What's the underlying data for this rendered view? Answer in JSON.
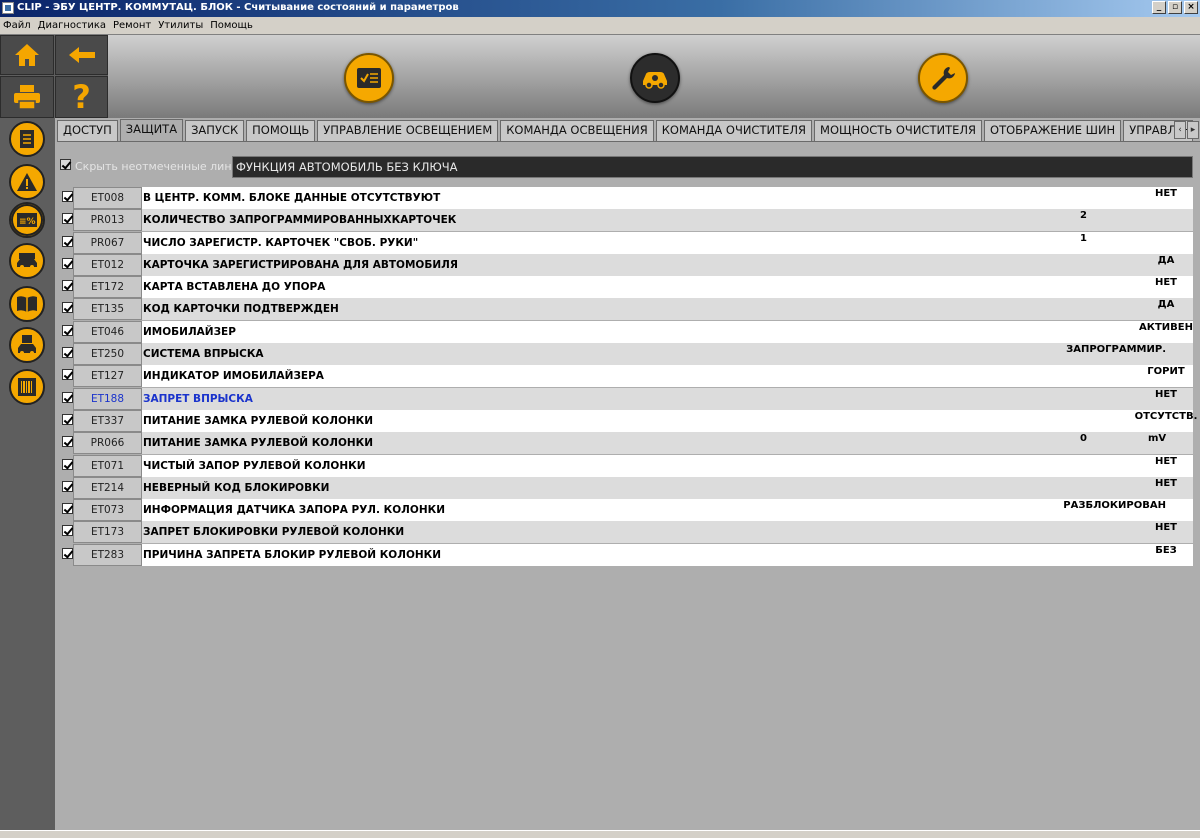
{
  "window": {
    "title": "CLIP - ЭБУ ЦЕНТР. КОММУТАЦ. БЛОК - Считывание состояний и параметров",
    "buttons": [
      "_",
      "▫",
      "×"
    ]
  },
  "menu": [
    "Файл",
    "Диагностика",
    "Ремонт",
    "Утилиты",
    "Помощь"
  ],
  "toolbar": {
    "home_icon": "home-icon",
    "back_icon": "back-arrow-icon",
    "print_icon": "printer-icon",
    "help_label": "?",
    "center_buttons": [
      "checklist-icon",
      "car-diagnostic-icon",
      "wrench-icon"
    ],
    "accent_color": "#f5a800"
  },
  "sidebar": {
    "icons": [
      "document-icon",
      "warning-icon",
      "parameters-icon",
      "vehicle-info-icon",
      "manual-book-icon",
      "save-vehicle-icon",
      "barcode-icon"
    ]
  },
  "tabs": [
    {
      "label": "ДОСТУП",
      "active": false
    },
    {
      "label": "ЗАЩИТА",
      "active": true
    },
    {
      "label": "ЗАПУСК",
      "active": false
    },
    {
      "label": "ПОМОЩЬ",
      "active": false
    },
    {
      "label": "УПРАВЛЕНИЕ ОСВЕЩЕНИЕМ",
      "active": false
    },
    {
      "label": "КОМАНДА ОСВЕЩЕНИЯ",
      "active": false
    },
    {
      "label": "КОМАНДА ОЧИСТИТЕЛЯ",
      "active": false
    },
    {
      "label": "МОЩНОСТЬ ОЧИСТИТЕЛЯ",
      "active": false
    },
    {
      "label": "ОТОБРАЖЕНИЕ ШИН",
      "active": false
    },
    {
      "label": "УПРАВЛЕНИЕ Г",
      "active": false
    }
  ],
  "filter": {
    "hide_unchecked_label": "Скрыть неотмеченные линии",
    "hide_unchecked_checked": true,
    "function_label": "ФУНКЦИЯ АВТОМОБИЛЬ БЕЗ КЛЮЧА"
  },
  "rows": [
    {
      "code": "ET008",
      "desc": "В ЦЕНТР. КОММ. БЛОКЕ ДАННЫЕ ОТСУТСТВУЮТ",
      "value": "НЕТ",
      "unit": ""
    },
    {
      "code": "PR013",
      "desc": "КОЛИЧЕСТВО ЗАПРОГРАММИРОВАННЫХКАРТОЧЕК",
      "value": "2",
      "unit": ""
    },
    {
      "code": "PR067",
      "desc": "ЧИСЛО ЗАРЕГИСТР. КАРТОЧЕК \"СВОБ. РУКИ\"",
      "value": "1",
      "unit": ""
    },
    {
      "code": "ET012",
      "desc": "КАРТОЧКА ЗАРЕГИСТРИРОВАНА ДЛЯ АВТОМОБИЛЯ",
      "value": "ДА",
      "unit": ""
    },
    {
      "code": "ET172",
      "desc": "КАРТА ВСТАВЛЕНА ДО УПОРА",
      "value": "НЕТ",
      "unit": ""
    },
    {
      "code": "ET135",
      "desc": "КОД КАРТОЧКИ ПОДТВЕРЖДЕН",
      "value": "ДА",
      "unit": ""
    },
    {
      "code": "ET046",
      "desc": "ИМОБИЛАЙЗЕР",
      "value": "АКТИВЕН",
      "unit": ""
    },
    {
      "code": "ET250",
      "desc": "СИСТЕМА ВПРЫСКА",
      "value": "ЗАПРОГРАММИР.",
      "unit": ""
    },
    {
      "code": "ET127",
      "desc": "ИНДИКАТОР ИМОБИЛАЙЗЕРА",
      "value": "ГОРИТ",
      "unit": ""
    },
    {
      "code": "ET188",
      "desc": "ЗАПРЕТ ВПРЫСКА",
      "value": "НЕТ",
      "unit": "",
      "highlight": true
    },
    {
      "code": "ET337",
      "desc": "ПИТАНИЕ ЗАМКА РУЛЕВОЙ КОЛОНКИ",
      "value": "ОТСУТСТВ.",
      "unit": ""
    },
    {
      "code": "PR066",
      "desc": "ПИТАНИЕ ЗАМКА РУЛЕВОЙ КОЛОНКИ",
      "value": "0",
      "unit": "mV"
    },
    {
      "code": "ET071",
      "desc": "ЧИСТЫЙ ЗАПОР РУЛЕВОЙ КОЛОНКИ",
      "value": "НЕТ",
      "unit": ""
    },
    {
      "code": "ET214",
      "desc": "НЕВЕРНЫЙ КОД БЛОКИРОВКИ",
      "value": "НЕТ",
      "unit": ""
    },
    {
      "code": "ET073",
      "desc": "ИНФОРМАЦИЯ ДАТЧИКА ЗАПОРА РУЛ. КОЛОНКИ",
      "value": "РАЗБЛОКИРОВАН",
      "unit": ""
    },
    {
      "code": "ET173",
      "desc": "ЗАПРЕТ БЛОКИРОВКИ РУЛЕВОЙ КОЛОНКИ",
      "value": "НЕТ",
      "unit": ""
    },
    {
      "code": "ET283",
      "desc": "ПРИЧИНА ЗАПРЕТА БЛОКИР РУЛЕВОЙ КОЛОНКИ",
      "value": "БЕЗ",
      "unit": ""
    }
  ]
}
